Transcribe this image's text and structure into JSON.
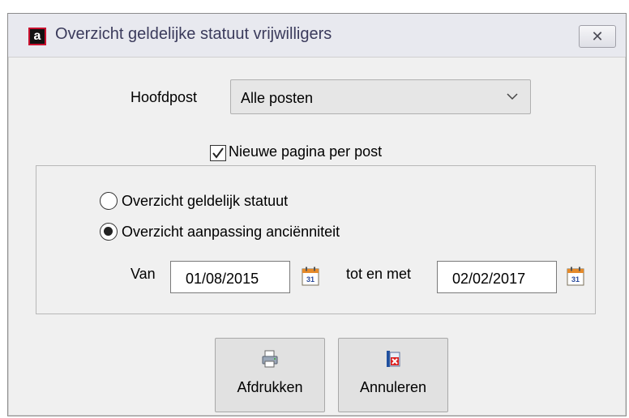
{
  "window": {
    "title": "Overzicht geldelijke statuut vrijwilligers",
    "icon_glyph": "a",
    "close_glyph": "✕"
  },
  "form": {
    "hoofdpost_label": "Hoofdpost",
    "hoofdpost_value": "Alle posten",
    "new_page_label": "Nieuwe pagina per post",
    "new_page_checked": true
  },
  "options": {
    "radio1_label": "Overzicht geldelijk statuut",
    "radio2_label": "Overzicht aanpassing anciënniteit",
    "selected": 2
  },
  "dates": {
    "van_label": "Van",
    "van_value": "01/08/2015",
    "tot_label": "tot en met",
    "tot_value": "02/02/2017",
    "calendar_day": "31"
  },
  "buttons": {
    "print_label": "Afdrukken",
    "cancel_label": "Annuleren"
  },
  "colors": {
    "accent_red": "#c8102e",
    "window_bg": "#f0f0f0"
  }
}
